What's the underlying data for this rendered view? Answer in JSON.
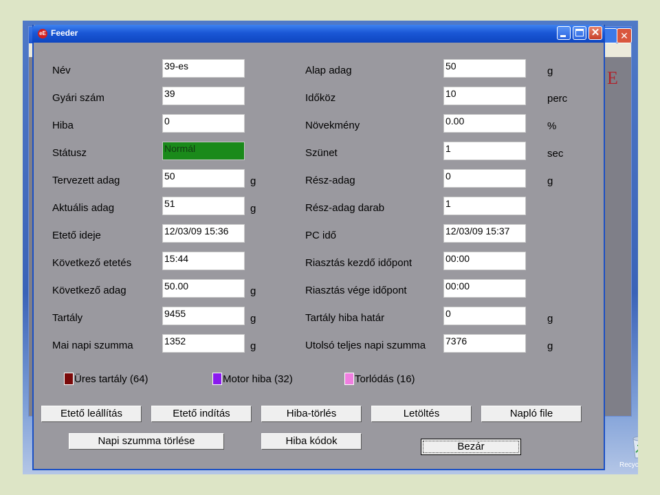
{
  "window": {
    "title": "Feeder",
    "app_icon": "eE"
  },
  "left_fields": [
    {
      "label": "Név",
      "value": "39-es",
      "unit": ""
    },
    {
      "label": "Gyári szám",
      "value": "39",
      "unit": ""
    },
    {
      "label": "Hiba",
      "value": "0",
      "unit": ""
    },
    {
      "label": "Státusz",
      "value": "Normál",
      "unit": "",
      "status_color": "#1a8a1a"
    },
    {
      "label": "Tervezett adag",
      "value": "50",
      "unit": "g"
    },
    {
      "label": "Aktuális adag",
      "value": "51",
      "unit": "g"
    },
    {
      "label": "Etető ideje",
      "value": "12/03/09 15:36",
      "unit": ""
    },
    {
      "label": "Következő etetés",
      "value": "15:44",
      "unit": ""
    },
    {
      "label": "Következő adag",
      "value": "50.00",
      "unit": "g"
    },
    {
      "label": "Tartály",
      "value": "9455",
      "unit": "g"
    },
    {
      "label": "Mai napi szumma",
      "value": "1352",
      "unit": "g"
    }
  ],
  "right_fields": [
    {
      "label": "Alap adag",
      "value": "50",
      "unit": "g"
    },
    {
      "label": "Időköz",
      "value": "10",
      "unit": "perc"
    },
    {
      "label": "Növekmény",
      "value": "0.00",
      "unit": "%"
    },
    {
      "label": "Szünet",
      "value": "1",
      "unit": "sec"
    },
    {
      "label": "Rész-adag",
      "value": "0",
      "unit": "g"
    },
    {
      "label": "Rész-adag darab",
      "value": "1",
      "unit": ""
    },
    {
      "label": "PC idő",
      "value": "12/03/09 15:37",
      "unit": ""
    },
    {
      "label": "Riasztás kezdő időpont",
      "value": "00:00",
      "unit": ""
    },
    {
      "label": "Riasztás vége időpont",
      "value": "00:00",
      "unit": ""
    },
    {
      "label": "Tartály hiba határ",
      "value": "0",
      "unit": "g"
    },
    {
      "label": "Utolsó teljes napi szumma",
      "value": "7376",
      "unit": "g"
    }
  ],
  "legend": [
    {
      "label": "Üres tartály (64)",
      "color": "#7a0a0a"
    },
    {
      "label": "Motor hiba (32)",
      "color": "#8a1aee"
    },
    {
      "label": "Torlódás (16)",
      "color": "#f07ee0"
    }
  ],
  "buttons": {
    "row1": [
      "Etető leállítás",
      "Etető indítás",
      "Hiba-törlés",
      "Letöltés",
      "Napló file"
    ],
    "napi_szumma_torlese": "Napi szumma törlése",
    "hiba_kodok": "Hiba kódok",
    "bezar": "Bezár"
  },
  "desktop": {
    "recycle_label": "Recyc"
  }
}
